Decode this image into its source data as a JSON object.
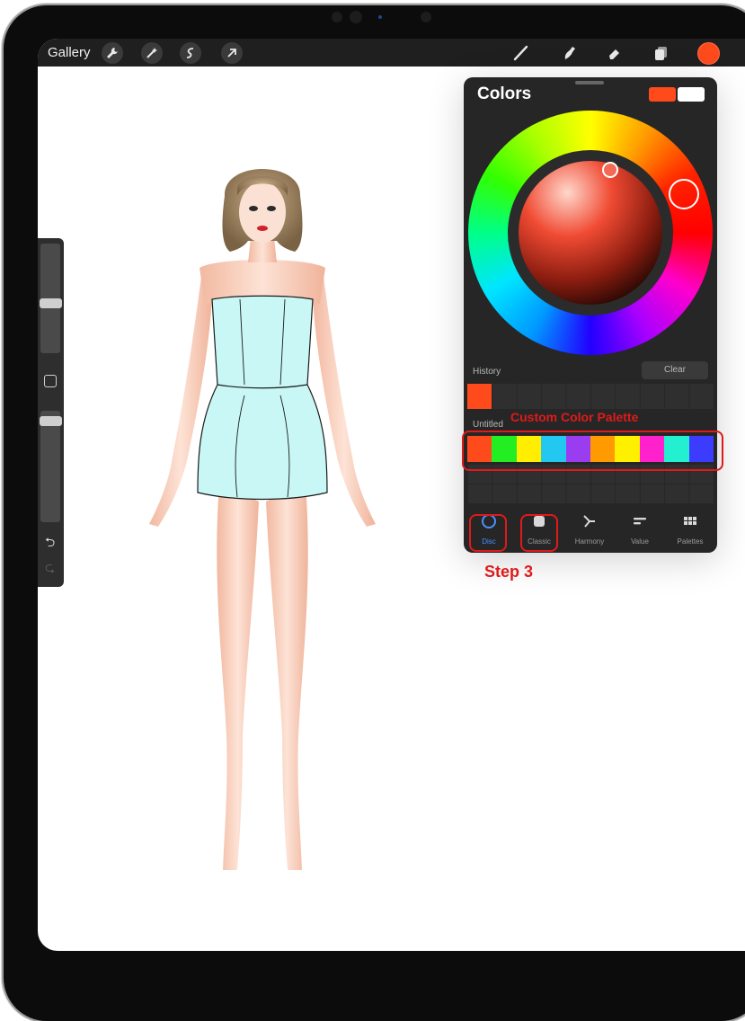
{
  "toolbar": {
    "gallery_label": "Gallery",
    "left_icons": [
      "wrench-icon",
      "magic-wand-icon",
      "selection-icon",
      "transform-arrow-icon"
    ],
    "right_icons": [
      "brush-icon",
      "smudge-icon",
      "eraser-icon",
      "layers-icon"
    ],
    "current_color": "#ff4a1c"
  },
  "sidebar": {
    "brush_size_level": 0.45,
    "opacity_level": 0.95
  },
  "colors_panel": {
    "title": "Colors",
    "primary_color": "#ff4a1c",
    "secondary_color": "#ffffff",
    "history": {
      "label": "History",
      "clear_label": "Clear",
      "swatches": [
        "#ff4a1c"
      ]
    },
    "palette": {
      "name": "Untitled",
      "swatches": [
        "#ff4a1c",
        "#22ee22",
        "#ffee00",
        "#22c8f0",
        "#9a3cf0",
        "#ff9a00",
        "#fff000",
        "#ff22cc",
        "#22f0d0",
        "#3c3cff"
      ]
    },
    "tabs": [
      {
        "label": "Disc"
      },
      {
        "label": "Classic"
      },
      {
        "label": "Harmony"
      },
      {
        "label": "Value"
      },
      {
        "label": "Palettes"
      }
    ]
  },
  "annotations": {
    "palette_caption": "Custom Color Palette",
    "step_caption": "Step 3",
    "color": "#e01a1a"
  }
}
